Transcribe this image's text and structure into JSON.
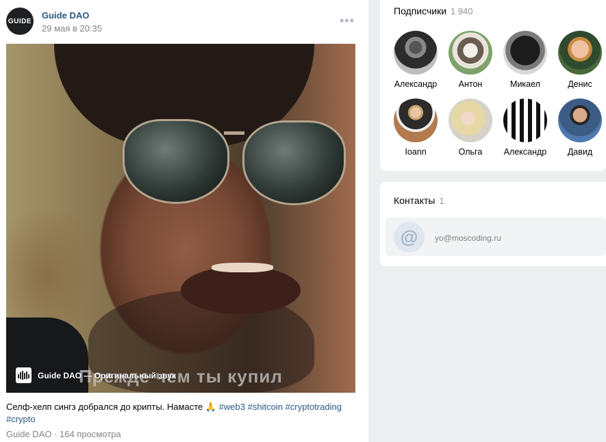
{
  "post": {
    "author": "Guide DAO",
    "avatar_text": "GUIDE",
    "date": "29 мая в 20:35",
    "more": "•••",
    "video": {
      "sound_label": "Guide DAO — Оригинальный звук",
      "subtitle": "Прежде чем ты купил"
    },
    "caption_text": "Селф-хелп сингз добрался до крипты. Намасте 🙏",
    "hashtags": [
      "#web3",
      "#shitcoin",
      "#cryptotrading",
      "#crypto"
    ],
    "footer_text": "Guide DAO · 164 просмотра"
  },
  "subscribers": {
    "title": "Подписчики",
    "count": "1 940",
    "items": [
      {
        "name": "Александр",
        "icon": "avatar-man-cigarette"
      },
      {
        "name": "Антон",
        "icon": "avatar-husky-puppy"
      },
      {
        "name": "Микаел",
        "icon": "avatar-curly-hair"
      },
      {
        "name": "Денис",
        "icon": "avatar-man-glasses"
      },
      {
        "name": "Ioann",
        "icon": "avatar-man-vest"
      },
      {
        "name": "Ольга",
        "icon": "avatar-blonde-woman"
      },
      {
        "name": "Александр",
        "icon": "avatar-pattern"
      },
      {
        "name": "Давид",
        "icon": "avatar-man-shirt"
      }
    ]
  },
  "contacts": {
    "title": "Контакты",
    "count": "1",
    "email": "yo@moscoding.ru",
    "icon_glyph": "@"
  }
}
